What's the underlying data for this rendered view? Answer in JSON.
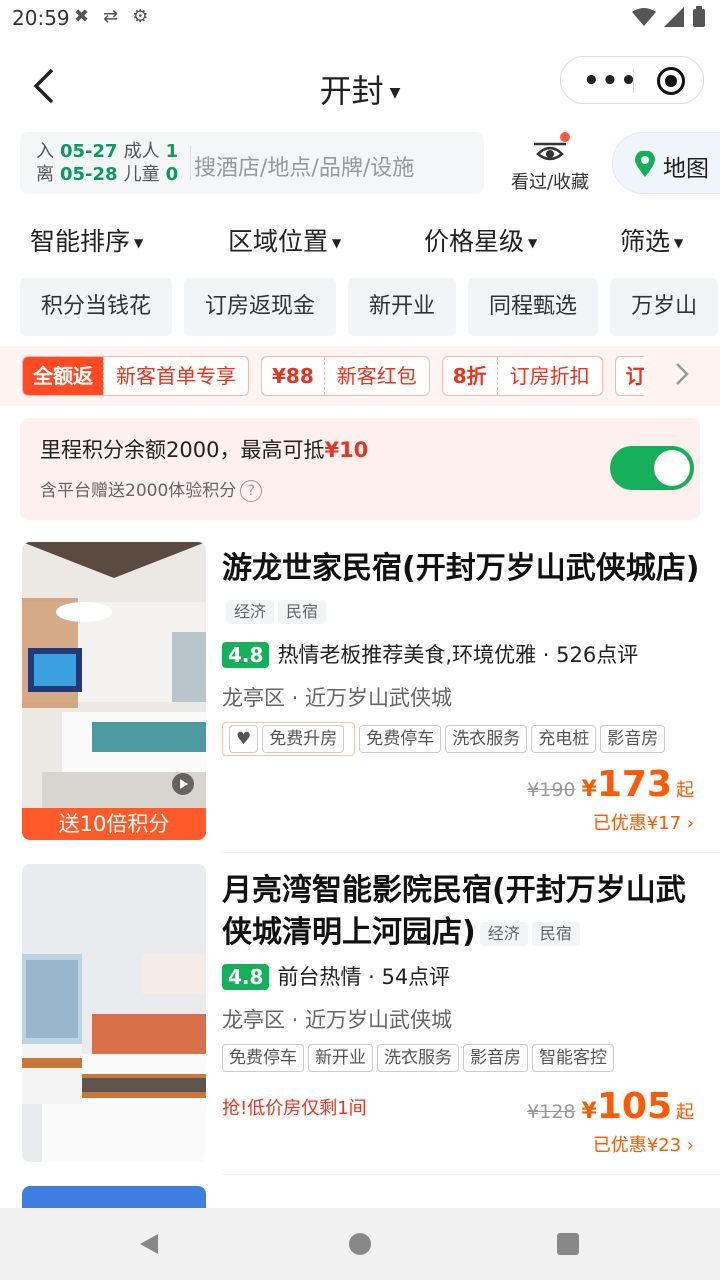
{
  "status": {
    "time": "20:59"
  },
  "nav": {
    "city": "开封"
  },
  "search": {
    "checkin_label": "入",
    "checkin_date": "05-27",
    "checkout_label": "离",
    "checkout_date": "05-28",
    "adults_label": "成人",
    "adults": "1",
    "children_label": "儿童",
    "children": "0",
    "placeholder": "搜酒店/地点/品牌/设施"
  },
  "seen_label": "看过/收藏",
  "map_label": "地图",
  "sorts": [
    "智能排序",
    "区域位置",
    "价格星级",
    "筛选"
  ],
  "chips": [
    "积分当钱花",
    "订房返现金",
    "新开业",
    "同程甄选",
    "万岁山"
  ],
  "promos": [
    {
      "a": "全额返",
      "b": "新客首单专享"
    },
    {
      "a": "¥88",
      "b": "新客红包"
    },
    {
      "a": "8折",
      "b": "订房折扣"
    },
    {
      "a": "订",
      "b": ""
    }
  ],
  "points": {
    "text": "里程积分余额2000，最高可抵",
    "amount": "¥10",
    "sub": "含平台赠送2000体验积分",
    "toggle_on": true
  },
  "hotels": [
    {
      "name": "游龙世家民宿(开封万岁山武侠城店)",
      "tags": [
        "经济",
        "民宿"
      ],
      "score": "4.8",
      "review": "热情老板推荐美食,环境优雅 · 526点评",
      "location": "龙亭区 · 近万岁山武侠城",
      "facilities": [
        "免费升房",
        "免费停车",
        "洗衣服务",
        "充电桩",
        "影音房"
      ],
      "photo_badge": "送10倍积分",
      "old_price": "¥190",
      "price": "173",
      "qi": "起",
      "saved": "已优惠¥17"
    },
    {
      "name": "月亮湾智能影院民宿(开封万岁山武侠城清明上河园店)",
      "tags": [
        "经济",
        "民宿"
      ],
      "score": "4.8",
      "review": "前台热情 · 54点评",
      "location": "龙亭区 · 近万岁山武侠城",
      "facilities": [
        "免费停车",
        "新开业",
        "洗衣服务",
        "影音房",
        "智能客控"
      ],
      "urgent": "抢!低价房仅剩1间",
      "old_price": "¥128",
      "price": "105",
      "qi": "起",
      "saved": "已优惠¥23"
    }
  ],
  "colors": {
    "accent_green": "#16b05a",
    "price_orange": "#ff5a00",
    "promo_red": "#e8331f"
  }
}
